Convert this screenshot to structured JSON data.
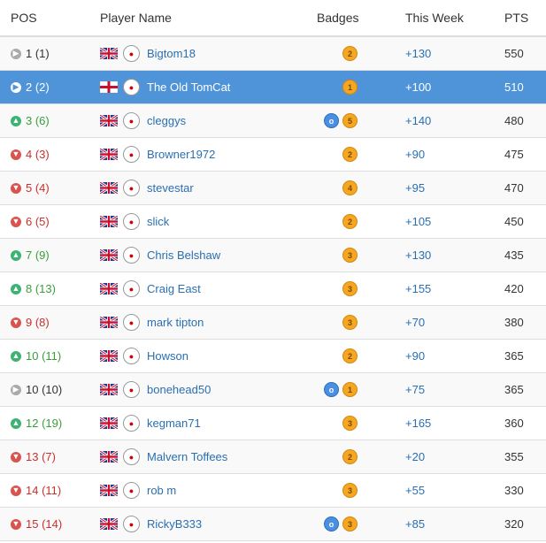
{
  "headers": {
    "pos": "POS",
    "name": "Player Name",
    "badges": "Badges",
    "week": "This Week",
    "pts": "PTS"
  },
  "colors": {
    "highlight": "#4f94d8",
    "up": "#3cb371",
    "down": "#d9534f",
    "link": "#2a6fb0",
    "badge_gold": "#f5a623",
    "badge_blue": "#4a90e2"
  },
  "rows": [
    {
      "trend": "same",
      "pos": "1 (1)",
      "flag": "gb-flag",
      "crest": "crest-icon",
      "name": "Bigtom18",
      "badges": [
        {
          "type": "gold",
          "label": "2"
        }
      ],
      "week": "+130",
      "pts": "550"
    },
    {
      "trend": "same",
      "pos": "2 (2)",
      "flag": "england-flag",
      "crest": "crest-icon",
      "name": "The Old TomCat",
      "badges": [
        {
          "type": "gold",
          "label": "1"
        }
      ],
      "week": "+100",
      "pts": "510",
      "highlight": true
    },
    {
      "trend": "up",
      "pos": "3 (6)",
      "flag": "gb-flag",
      "crest": "crest-icon",
      "name": "cleggys",
      "badges": [
        {
          "type": "blue",
          "label": "o"
        },
        {
          "type": "gold",
          "label": "5"
        }
      ],
      "week": "+140",
      "pts": "480"
    },
    {
      "trend": "down",
      "pos": "4 (3)",
      "flag": "gb-flag",
      "crest": "crest-icon",
      "name": "Browner1972",
      "badges": [
        {
          "type": "gold",
          "label": "2"
        }
      ],
      "week": "+90",
      "pts": "475"
    },
    {
      "trend": "down",
      "pos": "5 (4)",
      "flag": "gb-flag",
      "crest": "crest-icon",
      "name": "stevestar",
      "badges": [
        {
          "type": "gold",
          "label": "4"
        }
      ],
      "week": "+95",
      "pts": "470"
    },
    {
      "trend": "down",
      "pos": "6 (5)",
      "flag": "gb-flag",
      "crest": "crest-icon",
      "name": "slick",
      "badges": [
        {
          "type": "gold",
          "label": "2"
        }
      ],
      "week": "+105",
      "pts": "450"
    },
    {
      "trend": "up",
      "pos": "7 (9)",
      "flag": "gb-flag",
      "crest": "crest-icon",
      "name": "Chris Belshaw",
      "badges": [
        {
          "type": "gold",
          "label": "3"
        }
      ],
      "week": "+130",
      "pts": "435"
    },
    {
      "trend": "up",
      "pos": "8 (13)",
      "flag": "gb-flag",
      "crest": "crest-icon",
      "name": "Craig East",
      "badges": [
        {
          "type": "gold",
          "label": "3"
        }
      ],
      "week": "+155",
      "pts": "420"
    },
    {
      "trend": "down",
      "pos": "9 (8)",
      "flag": "gb-flag",
      "crest": "crest-icon",
      "name": "mark tipton",
      "badges": [
        {
          "type": "gold",
          "label": "3"
        }
      ],
      "week": "+70",
      "pts": "380"
    },
    {
      "trend": "up",
      "pos": "10 (11)",
      "flag": "gb-flag",
      "crest": "crest-icon",
      "name": "Howson",
      "badges": [
        {
          "type": "gold",
          "label": "2"
        }
      ],
      "week": "+90",
      "pts": "365"
    },
    {
      "trend": "same",
      "pos": "10 (10)",
      "flag": "gb-flag",
      "crest": "crest-icon",
      "name": "bonehead50",
      "badges": [
        {
          "type": "blue",
          "label": "o"
        },
        {
          "type": "gold",
          "label": "1"
        }
      ],
      "week": "+75",
      "pts": "365"
    },
    {
      "trend": "up",
      "pos": "12 (19)",
      "flag": "gb-flag",
      "crest": "crest-icon",
      "name": "kegman71",
      "badges": [
        {
          "type": "gold",
          "label": "3"
        }
      ],
      "week": "+165",
      "pts": "360"
    },
    {
      "trend": "down",
      "pos": "13 (7)",
      "flag": "gb-flag",
      "crest": "crest-icon",
      "name": "Malvern Toffees",
      "badges": [
        {
          "type": "gold",
          "label": "2"
        }
      ],
      "week": "+20",
      "pts": "355"
    },
    {
      "trend": "down",
      "pos": "14 (11)",
      "flag": "gb-flag",
      "crest": "crest-icon",
      "name": "rob m",
      "badges": [
        {
          "type": "gold",
          "label": "3"
        }
      ],
      "week": "+55",
      "pts": "330"
    },
    {
      "trend": "down",
      "pos": "15 (14)",
      "flag": "gb-flag",
      "crest": "crest-icon",
      "name": "RickyB333",
      "badges": [
        {
          "type": "blue",
          "label": "o"
        },
        {
          "type": "gold",
          "label": "3"
        }
      ],
      "week": "+85",
      "pts": "320"
    }
  ]
}
